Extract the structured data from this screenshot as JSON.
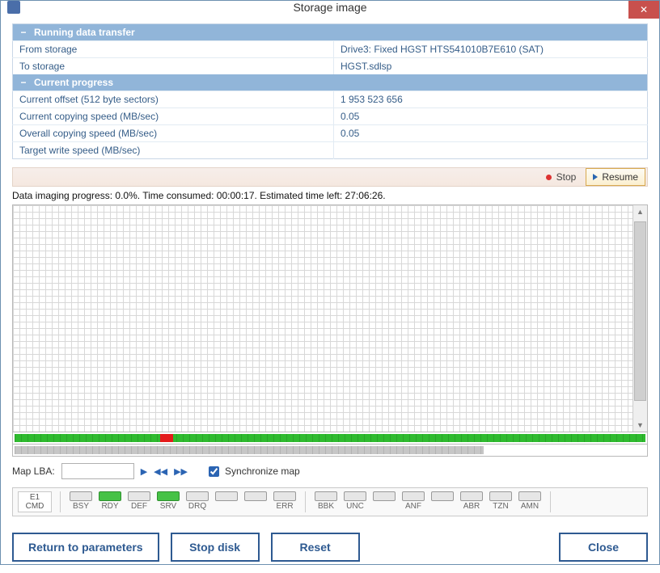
{
  "window": {
    "title": "Storage image"
  },
  "sections": {
    "transfer_header": "Running data transfer",
    "from_label": "From storage",
    "from_value": "Drive3: Fixed HGST HTS541010B7E610 (SAT)",
    "to_label": "To storage",
    "to_value": "HGST.sdlsp",
    "progress_header": "Current progress",
    "offset_label": "Current offset (512 byte sectors)",
    "offset_value": "1 953 523 656",
    "cur_speed_label": "Current copying speed (MB/sec)",
    "cur_speed_value": "0.05",
    "ovr_speed_label": "Overall copying speed (MB/sec)",
    "ovr_speed_value": "0.05",
    "tgt_speed_label": "Target write speed (MB/sec)",
    "tgt_speed_value": ""
  },
  "strip": {
    "stop": "Stop",
    "resume": "Resume"
  },
  "progress_text": "Data imaging progress: 0.0%. Time consumed: 00:00:17. Estimated time left: 27:06:26.",
  "map": {
    "label": "Map LBA:",
    "value": "",
    "sync": "Synchronize map"
  },
  "status": {
    "cmd_code": "E1",
    "cmd_label": "CMD",
    "group1": [
      {
        "name": "BSY",
        "on": false
      },
      {
        "name": "RDY",
        "on": true
      },
      {
        "name": "DEF",
        "on": false
      },
      {
        "name": "SRV",
        "on": true
      },
      {
        "name": "DRQ",
        "on": false
      },
      {
        "name": "",
        "on": false
      },
      {
        "name": "",
        "on": false
      },
      {
        "name": "ERR",
        "on": false
      }
    ],
    "group2": [
      {
        "name": "BBK",
        "on": false
      },
      {
        "name": "UNC",
        "on": false
      },
      {
        "name": "",
        "on": false
      },
      {
        "name": "ANF",
        "on": false
      },
      {
        "name": "",
        "on": false
      },
      {
        "name": "ABR",
        "on": false
      },
      {
        "name": "TZN",
        "on": false
      },
      {
        "name": "AMN",
        "on": false
      }
    ]
  },
  "buttons": {
    "return": "Return to parameters",
    "stop_disk": "Stop disk",
    "reset": "Reset",
    "close": "Close"
  }
}
